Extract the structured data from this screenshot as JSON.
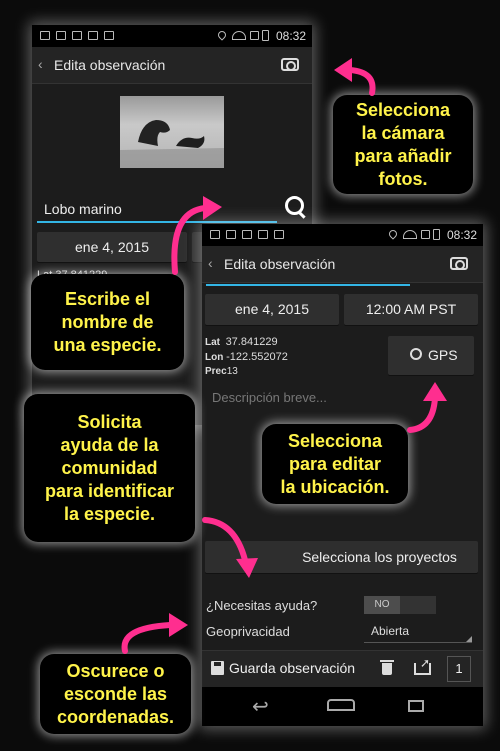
{
  "status": {
    "time": "08:32"
  },
  "screen1": {
    "title": "Edita observación",
    "species_value": "Lobo marino",
    "date": "ene 4, 2015",
    "coord_partial": "Lat 37.841229"
  },
  "screen2": {
    "title": "Edita observación",
    "date": "ene 4, 2015",
    "time": "12:00 AM PST",
    "lat_label": "Lat",
    "lat_value": "37.841229",
    "lon_label": "Lon",
    "lon_value": "-122.552072",
    "prec_label": "Prec",
    "prec_value": "13",
    "gps_label": "GPS",
    "description_placeholder": "Descripción breve...",
    "projects_button": "Selecciona los proyectos",
    "help_label": "¿Necesitas ayuda?",
    "help_toggle": "NO",
    "geoprivacy_label": "Geoprivacidad",
    "geoprivacy_value": "Abierta",
    "save_label": "Guarda observación",
    "photo_count": "1"
  },
  "callouts": {
    "camera": [
      "Selecciona",
      "la cámara",
      "para añadir",
      "fotos."
    ],
    "species": [
      "Escribe el",
      "nombre de",
      "una especie."
    ],
    "community": [
      "Solicita",
      "ayuda de la",
      "comunidad",
      "para identificar",
      "la especie."
    ],
    "location": [
      "Selecciona",
      "para editar",
      "la ubicación."
    ],
    "coords": [
      "Oscurece o",
      "esconde las",
      "coordenadas."
    ]
  },
  "colors": {
    "callout_text": "#fff34a",
    "arrow": "#ff2e8f",
    "accent": "#33b5e5"
  }
}
